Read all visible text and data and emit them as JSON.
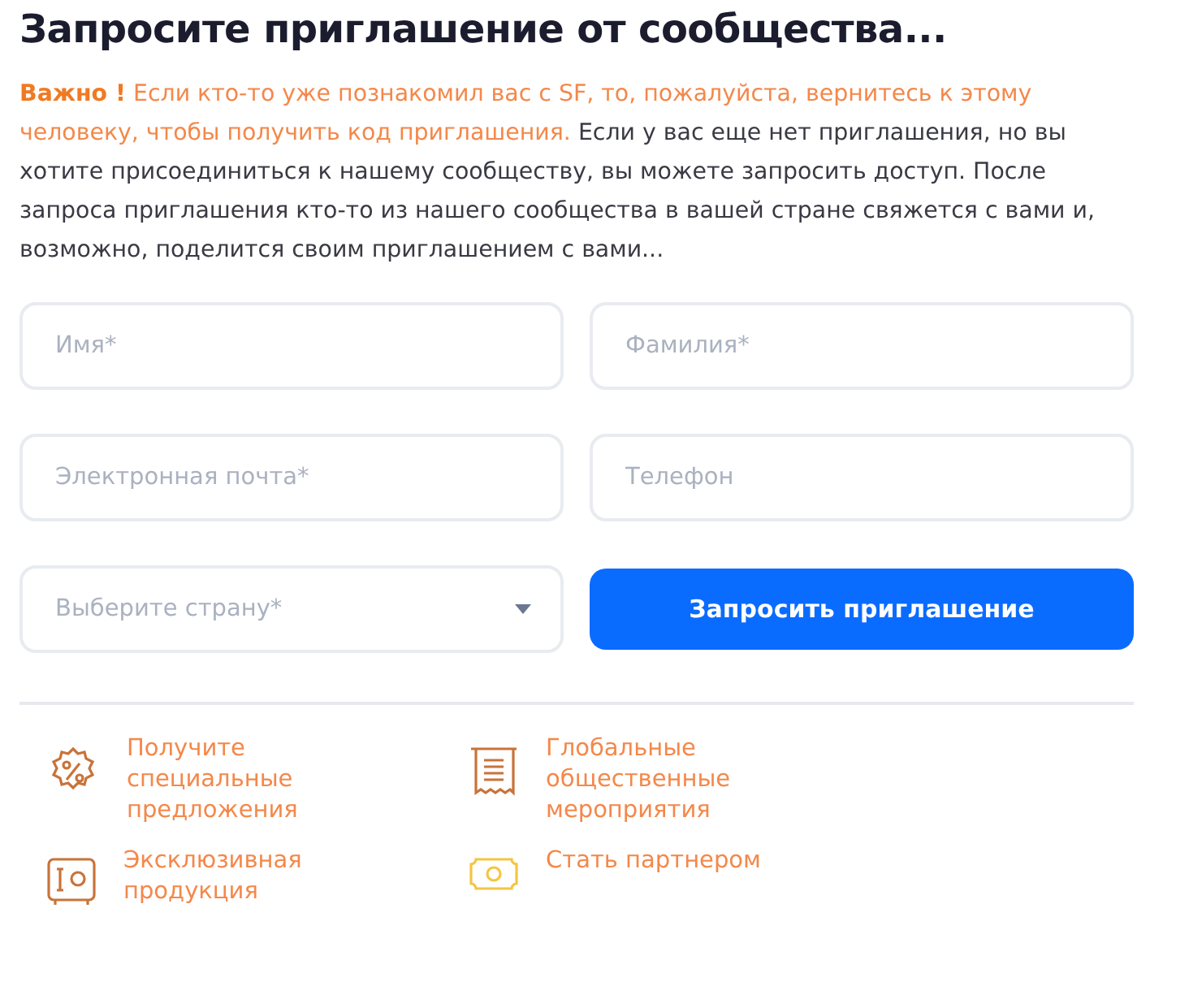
{
  "title": "Запросите приглашение от сообщества...",
  "notice": {
    "label": "Важно !",
    "highlight": "Если кто-то уже познакомил вас с SF, то, пожалуйста, вернитесь к этому человеку, чтобы получить код приглашения.",
    "body": "Если у вас еще нет приглашения, но вы хотите присоединиться к нашему сообществу, вы можете запросить доступ. После запроса приглашения кто-то из нашего сообщества в вашей стране свяжется с вами и, возможно, поделится своим приглашением с вами..."
  },
  "form": {
    "fields": [
      {
        "kind": "input",
        "placeholder": "Имя*"
      },
      {
        "kind": "input",
        "placeholder": "Фамилия*"
      },
      {
        "kind": "input",
        "placeholder": "Электронная почта*"
      },
      {
        "kind": "input",
        "placeholder": "Телефон"
      },
      {
        "kind": "select",
        "placeholder": "Выберите страну*"
      }
    ],
    "submit": "Запросить приглашение"
  },
  "features": [
    {
      "kind": "discount",
      "text": "Получите специальные предложения"
    },
    {
      "kind": "receipt",
      "text": "Глобальные общественные мероприятия"
    },
    {
      "kind": "safe",
      "text": "Эксклюзивная продукция"
    },
    {
      "kind": "money",
      "text": "Стать партнером"
    }
  ]
}
